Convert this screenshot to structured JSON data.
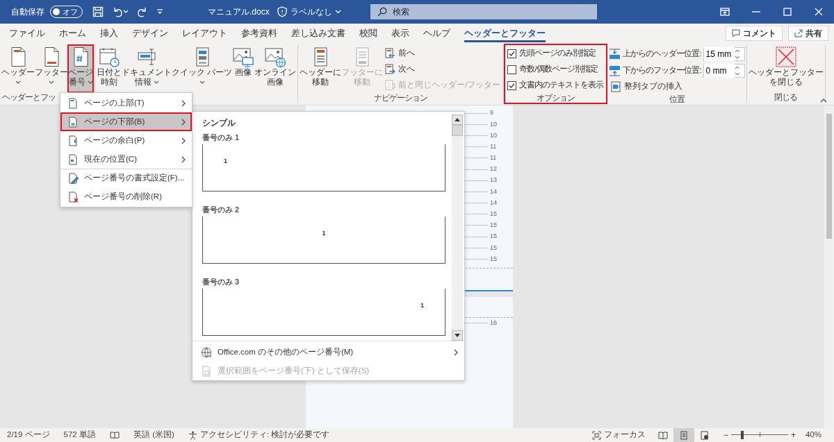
{
  "title_bar": {
    "autosave_label": "自動保存",
    "autosave_toggle": {
      "label": "オフ",
      "on": false
    },
    "document_title": "マニュアル.docx",
    "sensitivity_label": "ラベルなし",
    "search": {
      "placeholder": "検索"
    }
  },
  "tabs": [
    {
      "label": "ファイル",
      "selected": false
    },
    {
      "label": "ホーム",
      "selected": false
    },
    {
      "label": "挿入",
      "selected": false
    },
    {
      "label": "デザイン",
      "selected": false
    },
    {
      "label": "レイアウト",
      "selected": false
    },
    {
      "label": "参考資料",
      "selected": false
    },
    {
      "label": "差し込み文書",
      "selected": false
    },
    {
      "label": "校閲",
      "selected": false
    },
    {
      "label": "表示",
      "selected": false
    },
    {
      "label": "ヘルプ",
      "selected": false
    },
    {
      "label": "ヘッダーとフッター",
      "selected": true
    }
  ],
  "tab_buttons": [
    {
      "kind": "comment",
      "label": "コメント"
    },
    {
      "kind": "share",
      "label": "共有"
    }
  ],
  "ribbon_groups": [
    {
      "label": "ヘッダーとフッ",
      "highlighted": false,
      "items": [
        {
          "kind": "large",
          "lines": [
            "ヘッダー"
          ],
          "dropdown": true,
          "selected": false,
          "highlighted": false,
          "disabled": false
        },
        {
          "kind": "large",
          "lines": [
            "フッター"
          ],
          "dropdown": true,
          "selected": false,
          "highlighted": false,
          "disabled": false
        },
        {
          "kind": "large",
          "lines": [
            "ページ",
            "番号"
          ],
          "dropdown": true,
          "selected": true,
          "highlighted": true,
          "disabled": false
        }
      ]
    },
    {
      "highlighted": false,
      "items": [
        {
          "kind": "large",
          "lines": [
            "日付と",
            "時刻"
          ],
          "dropdown": false,
          "selected": false,
          "highlighted": false,
          "disabled": false
        },
        {
          "kind": "large",
          "lines": [
            "ドキュメント",
            "情報"
          ],
          "dropdown": true,
          "selected": false,
          "highlighted": false,
          "disabled": false
        },
        {
          "kind": "large",
          "lines": [
            "クイック パーツ"
          ],
          "dropdown": true,
          "selected": false,
          "highlighted": false,
          "disabled": false
        },
        {
          "kind": "large",
          "lines": [
            "画像"
          ],
          "dropdown": false,
          "selected": false,
          "highlighted": false,
          "disabled": false
        },
        {
          "kind": "large",
          "lines": [
            "オンライン",
            "画像"
          ],
          "dropdown": false,
          "selected": false,
          "highlighted": false,
          "disabled": false
        }
      ]
    },
    {
      "label": "ナビゲーション",
      "highlighted": false,
      "items": [
        {
          "kind": "large",
          "lines": [
            "ヘッダーに",
            "移動"
          ],
          "dropdown": false,
          "selected": false,
          "highlighted": false,
          "disabled": false
        },
        {
          "kind": "large",
          "lines": [
            "フッターに",
            "移動"
          ],
          "dropdown": false,
          "selected": false,
          "highlighted": false,
          "disabled": true
        },
        {
          "kind": "stack",
          "items": [
            {
              "kind": "small",
              "label": "前へ",
              "disabled": false
            },
            {
              "kind": "small",
              "label": "次へ",
              "disabled": false
            },
            {
              "kind": "small",
              "label": "前と同じヘッダー/フッター",
              "disabled": true
            }
          ]
        }
      ]
    },
    {
      "label": "オプション",
      "highlighted": true,
      "items": [
        {
          "kind": "stack",
          "items": [
            {
              "kind": "checkbox",
              "label": "先頭ページのみ別指定",
              "checked": true
            },
            {
              "kind": "checkbox",
              "label": "奇数/偶数ページ別指定",
              "checked": false
            },
            {
              "kind": "checkbox",
              "label": "文書内のテキストを表示",
              "checked": true
            }
          ]
        }
      ]
    },
    {
      "label": "位置",
      "highlighted": false,
      "items": [
        {
          "kind": "stack",
          "items": [
            {
              "kind": "spin",
              "label": "上からのヘッダー位置:",
              "value": "15 mm"
            },
            {
              "kind": "spin",
              "label": "下からのフッター位置:",
              "value": "0 mm"
            },
            {
              "kind": "small",
              "label": "整列タブの挿入",
              "disabled": false
            }
          ]
        }
      ]
    },
    {
      "label": "閉じる",
      "highlighted": false,
      "items": [
        {
          "kind": "large",
          "lines": [
            "ヘッダーとフッター",
            "を閉じる"
          ],
          "dropdown": false,
          "selected": false,
          "highlighted": false,
          "disabled": false
        }
      ]
    }
  ],
  "page_number_menu": {
    "items": [
      {
        "label": "ページの上部(T)",
        "submenu": true,
        "selected": false,
        "highlighted": false,
        "separator_before": false
      },
      {
        "label": "ページの下部(B)",
        "submenu": true,
        "selected": true,
        "highlighted": true,
        "separator_before": false
      },
      {
        "label": "ページの余白(P)",
        "submenu": true,
        "selected": false,
        "highlighted": false,
        "separator_before": false
      },
      {
        "label": "現在の位置(C)",
        "submenu": true,
        "selected": false,
        "highlighted": false,
        "separator_before": false
      },
      {
        "label": "ページ番号の書式設定(F)...",
        "submenu": false,
        "selected": false,
        "highlighted": false,
        "separator_before": true
      },
      {
        "label": "ページ番号の削除(R)",
        "submenu": false,
        "selected": false,
        "highlighted": false,
        "separator_before": false
      }
    ]
  },
  "bottom_gallery": {
    "heading": "シンプル",
    "items": [
      {
        "label": "番号のみ 1",
        "number": "1",
        "kind": "left"
      },
      {
        "label": "番号のみ 2",
        "number": "1",
        "kind": "center"
      },
      {
        "label": "番号のみ 3",
        "number": "1",
        "kind": "right"
      }
    ],
    "footer_items": [
      {
        "label": "Office.com のその他のページ番号(M)",
        "submenu": true,
        "disabled": false
      },
      {
        "label": "選択範囲をページ番号(下) として保存(S)",
        "submenu": false,
        "disabled": true
      }
    ]
  },
  "document": {
    "line_numbers": [
      "9",
      "10",
      "10",
      "11",
      "11",
      "12",
      "13",
      "14",
      "14",
      "15",
      "15",
      "15",
      "15",
      "15"
    ],
    "next_page_line_numbers": [
      "16"
    ]
  },
  "status_bar": {
    "items": [
      {
        "kind": "text",
        "label": "2/19 ページ"
      },
      {
        "kind": "text",
        "label": "572 単語"
      },
      {
        "kind": "proofing"
      },
      {
        "kind": "text",
        "label": "英語 (米国)"
      },
      {
        "kind": "accessibility",
        "label": "アクセシビリティ: 検討が必要です"
      }
    ],
    "focus_label": "フォーカス",
    "views": [
      {
        "kind": "read",
        "selected": false
      },
      {
        "kind": "print",
        "selected": true
      },
      {
        "kind": "web",
        "selected": false
      }
    ],
    "zoom": {
      "out": "−",
      "in": "+",
      "level": 0.2,
      "reading": "40%"
    }
  }
}
